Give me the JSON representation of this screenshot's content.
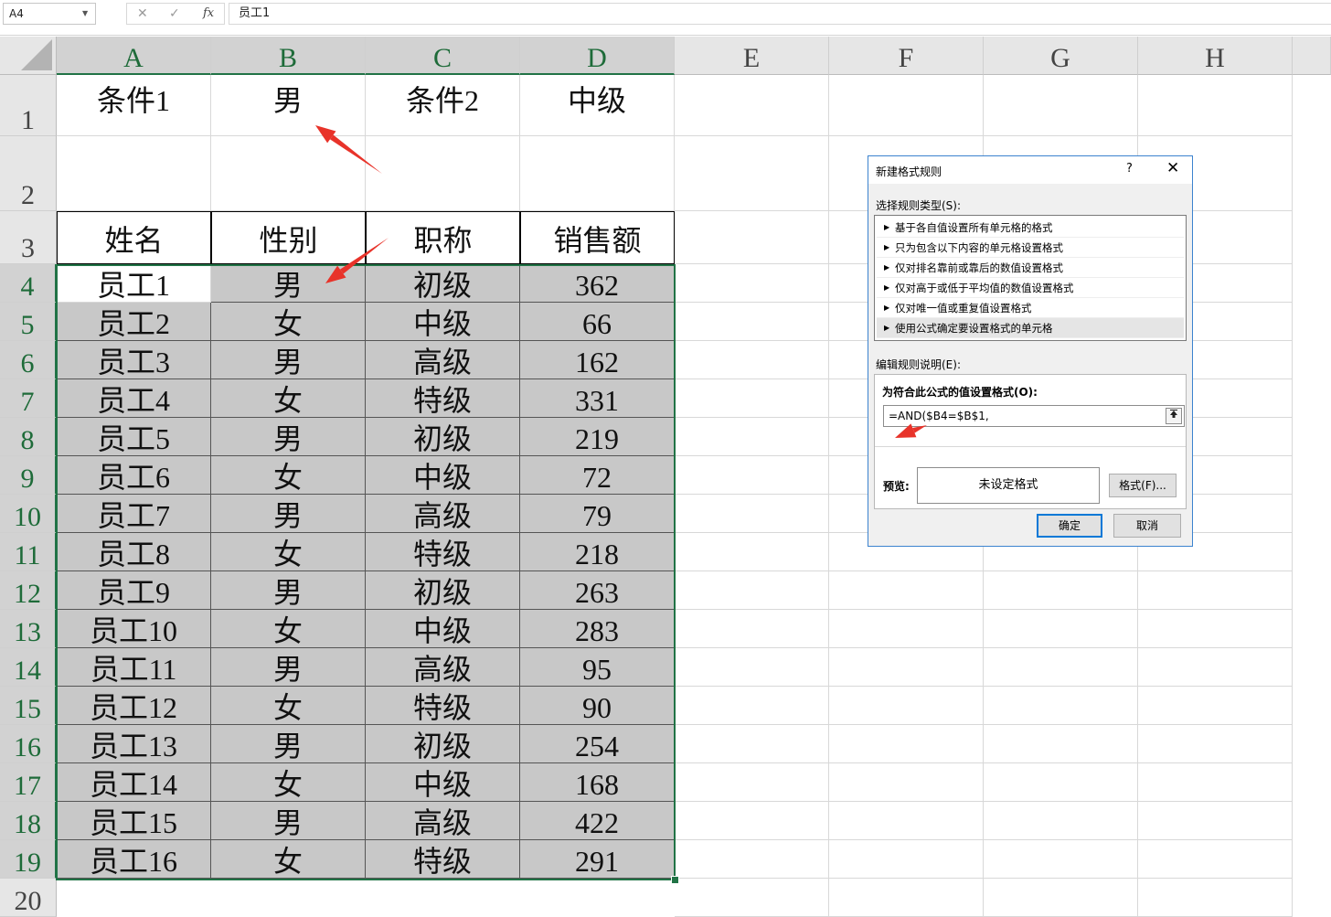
{
  "formula_bar": {
    "name_box": "A4",
    "cancel_icon": "✕",
    "enter_icon": "✓",
    "fx_icon": "fx",
    "content": "员工1"
  },
  "columns": [
    "A",
    "B",
    "C",
    "D",
    "E",
    "F",
    "G",
    "H"
  ],
  "rows": [
    "1",
    "2",
    "3",
    "4",
    "5",
    "6",
    "7",
    "8",
    "9",
    "10",
    "11",
    "12",
    "13",
    "14",
    "15",
    "16",
    "17",
    "18",
    "19",
    "20"
  ],
  "cells": {
    "row1": [
      "条件1",
      "男",
      "条件2",
      "中级"
    ],
    "header": [
      "姓名",
      "性别",
      "职称",
      "销售额"
    ],
    "data": [
      [
        "员工1",
        "男",
        "初级",
        "362"
      ],
      [
        "员工2",
        "女",
        "中级",
        "66"
      ],
      [
        "员工3",
        "男",
        "高级",
        "162"
      ],
      [
        "员工4",
        "女",
        "特级",
        "331"
      ],
      [
        "员工5",
        "男",
        "初级",
        "219"
      ],
      [
        "员工6",
        "女",
        "中级",
        "72"
      ],
      [
        "员工7",
        "男",
        "高级",
        "79"
      ],
      [
        "员工8",
        "女",
        "特级",
        "218"
      ],
      [
        "员工9",
        "男",
        "初级",
        "263"
      ],
      [
        "员工10",
        "女",
        "中级",
        "283"
      ],
      [
        "员工11",
        "男",
        "高级",
        "95"
      ],
      [
        "员工12",
        "女",
        "特级",
        "90"
      ],
      [
        "员工13",
        "男",
        "初级",
        "254"
      ],
      [
        "员工14",
        "女",
        "中级",
        "168"
      ],
      [
        "员工15",
        "男",
        "高级",
        "422"
      ],
      [
        "员工16",
        "女",
        "特级",
        "291"
      ]
    ]
  },
  "colors": {
    "selection": "#217346",
    "selected_fill": "#c8c8c8",
    "arrow": "#e8332a",
    "dialog_border": "#3c83cf"
  },
  "dialog": {
    "title": "新建格式规则",
    "help": "?",
    "close": "✕",
    "select_type_label": "选择规则类型(S):",
    "rule_types": [
      "基于各自值设置所有单元格的格式",
      "只为包含以下内容的单元格设置格式",
      "仅对排名靠前或靠后的数值设置格式",
      "仅对高于或低于平均值的数值设置格式",
      "仅对唯一值或重复值设置格式",
      "使用公式确定要设置格式的单元格"
    ],
    "selected_rule": 5,
    "edit_label": "编辑规则说明(E):",
    "formula_label": "为符合此公式的值设置格式(O):",
    "formula_value": "=AND($B4=$B$1,",
    "preview_label": "预览:",
    "preview_text": "未设定格式",
    "format_button": "格式(F)...",
    "ok_button": "确定",
    "cancel_button": "取消"
  }
}
